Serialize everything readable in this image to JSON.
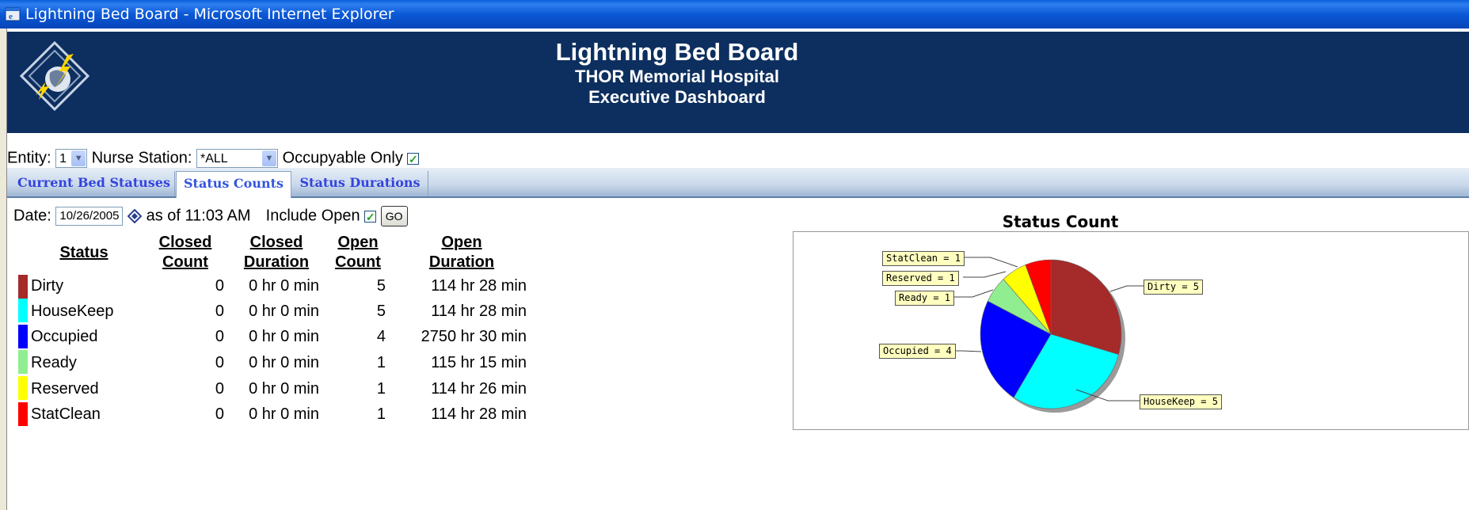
{
  "window": {
    "title": "Lightning Bed Board - Microsoft Internet Explorer"
  },
  "header": {
    "title": "Lightning Bed Board",
    "hospital": "THOR Memorial Hospital",
    "subtitle": "Executive Dashboard"
  },
  "filters": {
    "entity_label": "Entity:",
    "entity_value": "1",
    "nurse_station_label": "Nurse Station:",
    "nurse_station_value": "*ALL",
    "occupyable_label": "Occupyable Only",
    "occupyable_checked": true
  },
  "tabs": [
    {
      "label": "Current Bed Statuses",
      "active": false
    },
    {
      "label": "Status Counts",
      "active": true
    },
    {
      "label": "Status Durations",
      "active": false
    }
  ],
  "date_row": {
    "date_label": "Date:",
    "date_value": "10/26/2005",
    "as_of": "as of 11:03 AM",
    "include_open_label": "Include Open",
    "include_open_checked": true,
    "go_label": "GO"
  },
  "table": {
    "headers": {
      "status": "Status",
      "closed_count": [
        "Closed",
        "Count"
      ],
      "closed_duration": [
        "Closed",
        "Duration"
      ],
      "open_count": [
        "Open",
        "Count"
      ],
      "open_duration": [
        "Open",
        "Duration"
      ]
    },
    "rows": [
      {
        "status": "Dirty",
        "color": "#a52a2a",
        "closed_count": "0",
        "closed_duration": "0 hr 0 min",
        "open_count": "5",
        "open_duration": "114 hr 28 min"
      },
      {
        "status": "HouseKeep",
        "color": "#00ffff",
        "closed_count": "0",
        "closed_duration": "0 hr 0 min",
        "open_count": "5",
        "open_duration": "114 hr 28 min"
      },
      {
        "status": "Occupied",
        "color": "#0000ff",
        "closed_count": "0",
        "closed_duration": "0 hr 0 min",
        "open_count": "4",
        "open_duration": "2750 hr 30 min"
      },
      {
        "status": "Ready",
        "color": "#90ee90",
        "closed_count": "0",
        "closed_duration": "0 hr 0 min",
        "open_count": "1",
        "open_duration": "115 hr 15 min"
      },
      {
        "status": "Reserved",
        "color": "#ffff00",
        "closed_count": "0",
        "closed_duration": "0 hr 0 min",
        "open_count": "1",
        "open_duration": "114 hr 26 min"
      },
      {
        "status": "StatClean",
        "color": "#ff0000",
        "closed_count": "0",
        "closed_duration": "0 hr 0 min",
        "open_count": "1",
        "open_duration": "114 hr 28 min"
      }
    ]
  },
  "chart_data": {
    "type": "pie",
    "title": "Status Count",
    "slices": [
      {
        "label": "Dirty",
        "value": 5,
        "color": "#a52a2a",
        "callout": "Dirty = 5"
      },
      {
        "label": "HouseKeep",
        "value": 5,
        "color": "#00ffff",
        "callout": "HouseKeep = 5"
      },
      {
        "label": "Occupied",
        "value": 4,
        "color": "#0000ff",
        "callout": "Occupied = 4"
      },
      {
        "label": "Ready",
        "value": 1,
        "color": "#90ee90",
        "callout": "Ready = 1"
      },
      {
        "label": "Reserved",
        "value": 1,
        "color": "#ffff00",
        "callout": "Reserved = 1"
      },
      {
        "label": "StatClean",
        "value": 1,
        "color": "#ff0000",
        "callout": "StatClean = 1"
      }
    ]
  }
}
